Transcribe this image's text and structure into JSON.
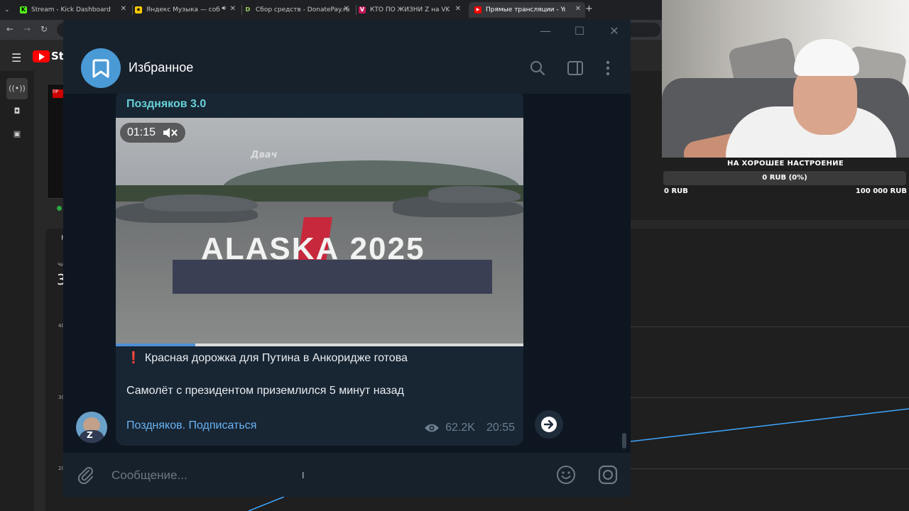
{
  "browser": {
    "tabs": [
      {
        "title": "Stream - Kick Dashboard",
        "favicon_color": "#53fc18",
        "favicon_char": "K"
      },
      {
        "title": "Яндекс Музыка — собирае",
        "favicon_color": "#ffcc00",
        "favicon_char": "★"
      },
      {
        "title": "Сбор средств - DonatePay.ru",
        "favicon_color": "#222222",
        "favicon_char": "D"
      },
      {
        "title": "КТО ПО ЖИЗНИ Z на VK Видео",
        "favicon_color": "#c2185b",
        "favicon_char": "V"
      },
      {
        "title": "Прямые трансляции - YouTube",
        "favicon_color": "#ff0000",
        "favicon_char": "▶"
      }
    ],
    "new_tab": "+"
  },
  "youtube": {
    "brand": "Stu",
    "live_badge": "ПР",
    "axis_labels": [
      "40",
      "30",
      "20"
    ],
    "side_digit": "3",
    "panel_letter": "Н",
    "small_label": "Чи"
  },
  "donation_widget": {
    "title": "НА ХОРОШЕЕ НАСТРОЕНИЕ",
    "current": "0 RUB (0%)",
    "min": "0 RUB",
    "max": "100 000 RUB",
    "progress_fraction": 0
  },
  "telegram": {
    "chat_title": "Избранное",
    "message": {
      "author": "Поздняков 3.0",
      "video_duration": "01:15",
      "video_watermark": "Двач",
      "video_banner_left": "ALASKA",
      "video_banner_right": "2025",
      "video_progress_fraction": 0.195,
      "exclaim": "❗",
      "line1": "Красная дорожка для Путина в Анкоридже готова",
      "line2": "Самолёт с президентом приземлился 5 минут назад",
      "link": "Поздняков. Подписаться",
      "views": "62.2K",
      "time": "20:55"
    },
    "composer_placeholder": "Сообщение..."
  },
  "colors": {
    "tg_bg": "#0e1621",
    "tg_header": "#17212b",
    "tg_bubble": "#182533",
    "tg_author": "#67d1d8",
    "tg_link": "#6ab3f3",
    "yt_red": "#ff0000"
  }
}
